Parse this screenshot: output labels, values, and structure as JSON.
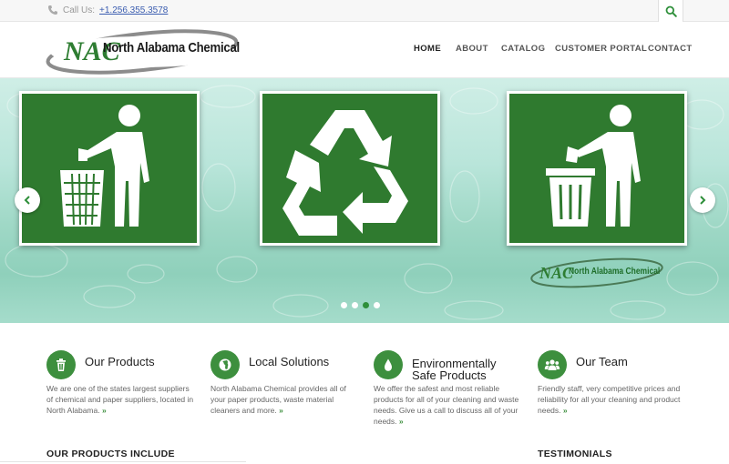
{
  "topbar": {
    "call_label": "Call Us:",
    "phone": "+1.256.355.3578"
  },
  "brand": {
    "logo_mark": "NAC",
    "name": "North Alabama Chemical",
    "color": "#2e7d32"
  },
  "nav": [
    {
      "label": "HOME",
      "active": true
    },
    {
      "label": "ABOUT"
    },
    {
      "label": "CATALOG"
    },
    {
      "label": "CUSTOMER PORTAL"
    },
    {
      "label": "CONTACT"
    }
  ],
  "slider": {
    "panels": [
      "person-trash-basket-icon",
      "recycle-icon",
      "person-trash-can-icon"
    ],
    "watermark_text": "North Alabama Chemical",
    "dots": 4,
    "active_dot": 3
  },
  "features": [
    {
      "icon": "trash-icon",
      "title": "Our Products",
      "desc": "We are one of the states largest suppliers of chemical and paper suppliers, located in North Alabama.",
      "more": "»"
    },
    {
      "icon": "globe-icon",
      "title": "Local Solutions",
      "desc": "North Alabama Chemical provides all of your paper products, waste material cleaners and more.",
      "more": "»"
    },
    {
      "icon": "drop-icon",
      "title": "Environmentally Safe Products",
      "desc": "We offer the safest and most reliable products for all of your cleaning and waste needs. Give us a call to discuss all of your needs.",
      "more": "»"
    },
    {
      "icon": "team-icon",
      "title": "Our Team",
      "desc": "Friendly staff, very competitive prices and reliability for all your cleaning and product needs.",
      "more": "»"
    }
  ],
  "sections": {
    "products_heading": "OUR PRODUCTS INCLUDE",
    "testimonials_heading": "TESTIMONIALS"
  }
}
